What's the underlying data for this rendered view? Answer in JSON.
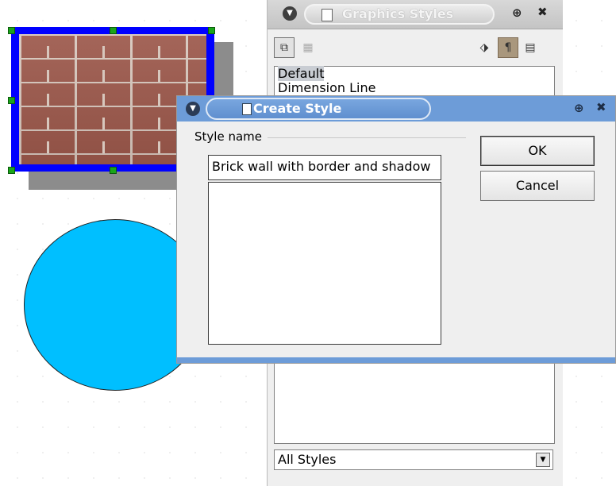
{
  "graphics_styles": {
    "title": "Graphics Styles",
    "styles": [
      "Default",
      "Dimension Line"
    ],
    "filter": "All Styles"
  },
  "dialog": {
    "title": "Create Style",
    "group_label": "Style name",
    "style_name_value": "Brick wall with border and shadow",
    "ok_label": "OK",
    "cancel_label": "Cancel"
  },
  "colors": {
    "shape_border": "#0000ff",
    "circle_fill": "#00bfff",
    "dialog_titlebar": "#6d9cd8"
  }
}
